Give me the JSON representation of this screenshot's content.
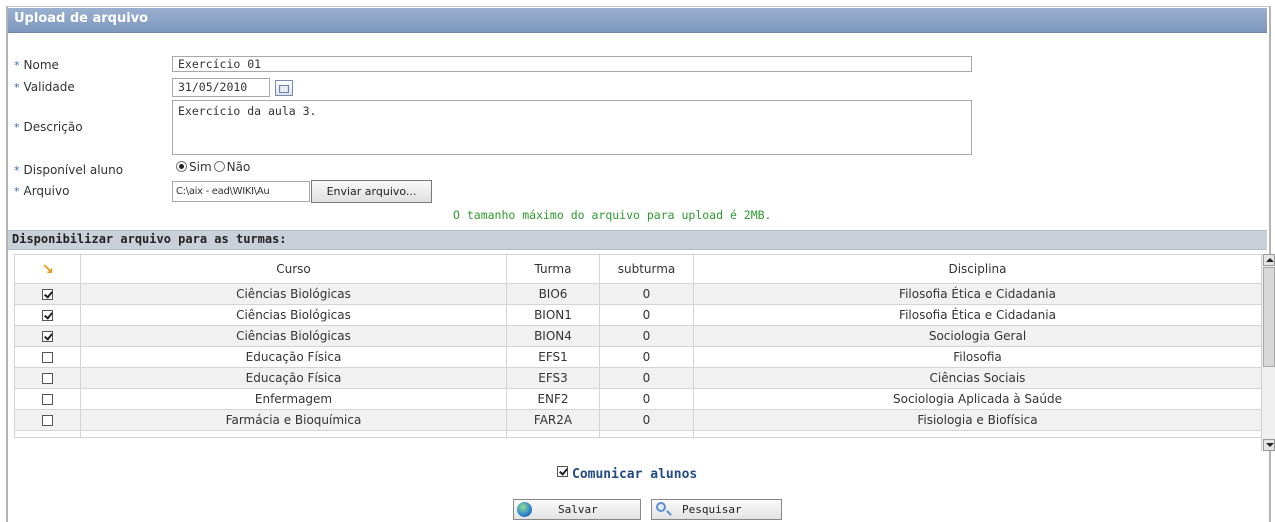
{
  "panel": {
    "title": "Upload de arquivo"
  },
  "form": {
    "nome_label": "Nome",
    "nome_value": "Exercício 01",
    "validade_label": "Validade",
    "validade_value": "31/05/2010",
    "descricao_label": "Descrição",
    "descricao_value": "Exercício da aula 3.",
    "disponivel_label": "Disponível aluno",
    "radio_sim": "Sim",
    "radio_nao": "Não",
    "radio_selected": "Sim",
    "arquivo_label": "Arquivo",
    "arquivo_value": "C:\\aix - ead\\WIKI\\Au",
    "enviar_button": "Enviar arquivo...",
    "max_size_hint": "O tamanho máximo do arquivo para upload é 2MB."
  },
  "turmas": {
    "section_title": "Disponibilizar arquivo para as turmas:",
    "columns": [
      "Curso",
      "Turma",
      "subturma",
      "Disciplina"
    ],
    "rows": [
      {
        "checked": true,
        "curso": "Ciências Biológicas",
        "turma": "BIO6",
        "subturma": "0",
        "disciplina": "Filosofia Ética e Cidadania"
      },
      {
        "checked": true,
        "curso": "Ciências Biológicas",
        "turma": "BION1",
        "subturma": "0",
        "disciplina": "Filosofia Ética e Cidadania"
      },
      {
        "checked": true,
        "curso": "Ciências Biológicas",
        "turma": "BION4",
        "subturma": "0",
        "disciplina": "Sociologia Geral"
      },
      {
        "checked": false,
        "curso": "Educação Física",
        "turma": "EFS1",
        "subturma": "0",
        "disciplina": "Filosofia"
      },
      {
        "checked": false,
        "curso": "Educação Física",
        "turma": "EFS3",
        "subturma": "0",
        "disciplina": "Ciências Sociais"
      },
      {
        "checked": false,
        "curso": "Enfermagem",
        "turma": "ENF2",
        "subturma": "0",
        "disciplina": "Sociologia Aplicada à Saúde"
      },
      {
        "checked": false,
        "curso": "Farmácia e Bioquímica",
        "turma": "FAR2A",
        "subturma": "0",
        "disciplina": "Fisiologia e Biofísica"
      }
    ]
  },
  "footer": {
    "comunicar_label": "Comunicar alunos",
    "comunicar_checked": true,
    "salvar_button": "Salvar",
    "pesquisar_button": "Pesquisar"
  },
  "icons": {
    "calendar": "calendar-icon",
    "sort": "sort-arrow-icon",
    "save": "globe-icon",
    "search": "magnifier-icon"
  },
  "colors": {
    "title_bar": "#8aa3c7",
    "section_bar": "#c9d0da",
    "hint_text": "#2e9a2e",
    "comunicar_text": "#224a88",
    "required_marker": "#3a6fb0"
  }
}
